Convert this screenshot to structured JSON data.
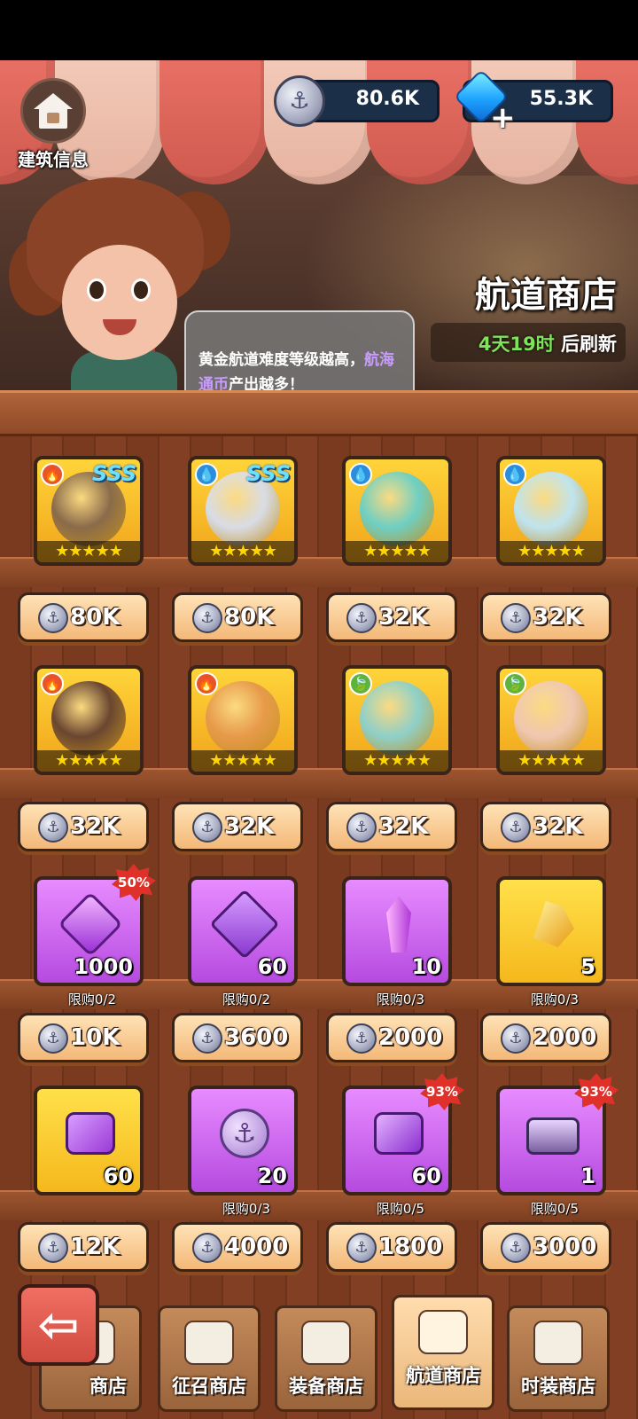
{
  "header": {
    "build_info_label": "建筑信息",
    "anchor_coins": "80.6K",
    "gems": "55.3K",
    "shop_title": "航道商店",
    "refresh_time": "4天19时",
    "refresh_suffix": "后刷新",
    "speech_pre": "黄金航道难度等级越高，",
    "speech_highlight": "航海通币",
    "speech_post": "产出越多！"
  },
  "items": [
    {
      "kind": "hero",
      "element": "fire",
      "rank": "SSS",
      "stars": "★★★★★",
      "price": "80K",
      "portrait": "#8a6b4a"
    },
    {
      "kind": "hero",
      "element": "water",
      "rank": "SSS",
      "stars": "★★★★★",
      "price": "80K",
      "portrait": "#d8dce6"
    },
    {
      "kind": "hero",
      "element": "water",
      "rank": "",
      "stars": "★★★★★",
      "price": "32K",
      "portrait": "#6fcfc2"
    },
    {
      "kind": "hero",
      "element": "water",
      "rank": "",
      "stars": "★★★★★",
      "price": "32K",
      "portrait": "#bfe4ef"
    },
    {
      "kind": "hero",
      "element": "fire",
      "rank": "",
      "stars": "★★★★★",
      "price": "32K",
      "portrait": "#6a4630"
    },
    {
      "kind": "hero",
      "element": "fire",
      "rank": "",
      "stars": "★★★★★",
      "price": "32K",
      "portrait": "#e79a4a"
    },
    {
      "kind": "hero",
      "element": "leaf",
      "rank": "",
      "stars": "★★★★★",
      "price": "32K",
      "portrait": "#8fd0c8"
    },
    {
      "kind": "hero",
      "element": "leaf",
      "rank": "",
      "stars": "★★★★★",
      "price": "32K",
      "portrait": "#f0c8b0"
    },
    {
      "kind": "item",
      "name": "purple-gem",
      "qty": "1000",
      "discount": "50%",
      "limit": "限购0/2",
      "price": "10K"
    },
    {
      "kind": "item",
      "name": "equipment-fragment",
      "qty": "60",
      "discount": "",
      "limit": "限购0/2",
      "price": "3600"
    },
    {
      "kind": "item",
      "name": "purple-crystal",
      "qty": "10",
      "discount": "",
      "limit": "限购0/3",
      "price": "2000"
    },
    {
      "kind": "item",
      "name": "gold-crystal",
      "qty": "5",
      "discount": "",
      "limit": "限购0/3",
      "price": "2000"
    },
    {
      "kind": "item",
      "name": "gold-armor-fragment",
      "qty": "60",
      "discount": "",
      "limit": "",
      "price": "12K"
    },
    {
      "kind": "item",
      "name": "anchor-coin",
      "qty": "20",
      "discount": "",
      "limit": "限购0/3",
      "price": "4000"
    },
    {
      "kind": "item",
      "name": "purple-armor-fragment",
      "qty": "60",
      "discount": "93%",
      "limit": "限购0/5",
      "price": "1800"
    },
    {
      "kind": "item",
      "name": "treasure-chest",
      "qty": "1",
      "discount": "93%",
      "limit": "限购0/5",
      "price": "3000"
    }
  ],
  "nav": {
    "tabs": [
      {
        "label": "商店",
        "active": false
      },
      {
        "label": "征召商店",
        "active": false
      },
      {
        "label": "装备商店",
        "active": false
      },
      {
        "label": "航道商店",
        "active": true
      },
      {
        "label": "时装商店",
        "active": false
      }
    ],
    "back_icon": "arrow-left-icon"
  },
  "colors": {
    "price_text": "#ffffff",
    "refresh_time": "#7ee35a",
    "highlight": "#c89cff",
    "discount_badge": "#e0302a"
  }
}
